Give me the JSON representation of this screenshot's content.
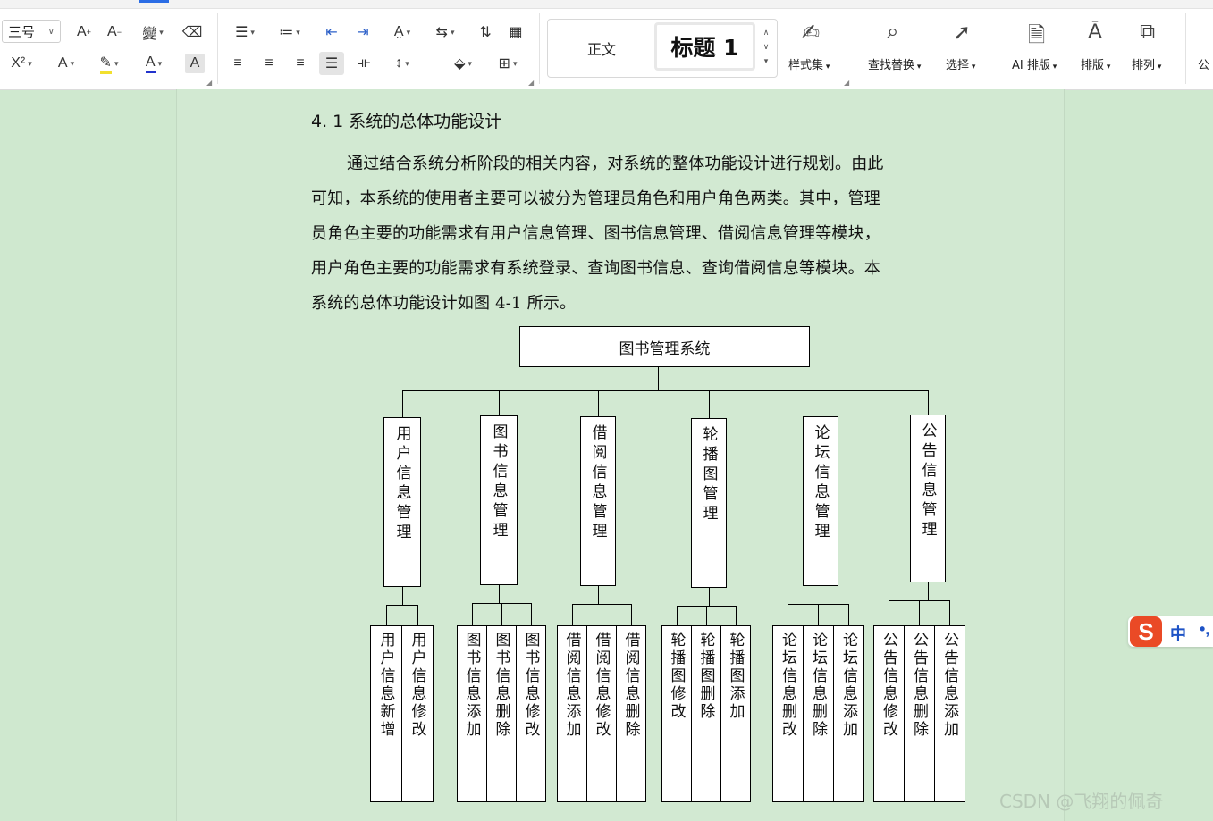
{
  "ribbon": {
    "font_size": "三号",
    "styles": {
      "normal": "正文",
      "heading1": "标题  1"
    },
    "labels": {
      "style_set": "样式集",
      "find_replace": "查找替换",
      "select": "选择",
      "ai_layout": "AI 排版",
      "layout": "排版",
      "arrange": "排列",
      "more": "公"
    }
  },
  "document": {
    "heading": "4. 1 系统的总体功能设计",
    "paragraph_lines": [
      "通过结合系统分析阶段的相关内容，对系统的整体功能设计进行规划。由此",
      "可知，本系统的使用者主要可以被分为管理员角色和用户角色两类。其中，管理",
      "员角色主要的功能需求有用户信息管理、图书信息管理、借阅信息管理等模块，",
      "用户角色主要的功能需求有系统登录、查询图书信息、查询借阅信息等模块。本",
      "系统的总体功能设计如图 4-1 所示。"
    ],
    "org_chart": {
      "root": "图书管理系统",
      "modules": [
        {
          "name": "用户信息管理",
          "children": [
            "用户信息新增",
            "用户信息修改"
          ]
        },
        {
          "name": "图书信息管理",
          "children": [
            "图书信息添加",
            "图书信息删除",
            "图书信息修改"
          ]
        },
        {
          "name": "借阅信息管理",
          "children": [
            "借阅信息添加",
            "借阅信息修改",
            "借阅信息删除"
          ]
        },
        {
          "name": "轮播图管理",
          "children": [
            "轮播图修改",
            "轮播图删除",
            "轮播图添加"
          ]
        },
        {
          "name": "论坛信息管理",
          "children": [
            "论坛信息删改",
            "论坛信息删除",
            "论坛信息添加"
          ]
        },
        {
          "name": "公告信息管理",
          "children": [
            "公告信息修改",
            "公告信息删除",
            "公告信息添加"
          ]
        }
      ]
    }
  },
  "ime": {
    "lang": "中",
    "punct": "•,"
  },
  "watermark": "CSDN @飞翔的佩奇"
}
